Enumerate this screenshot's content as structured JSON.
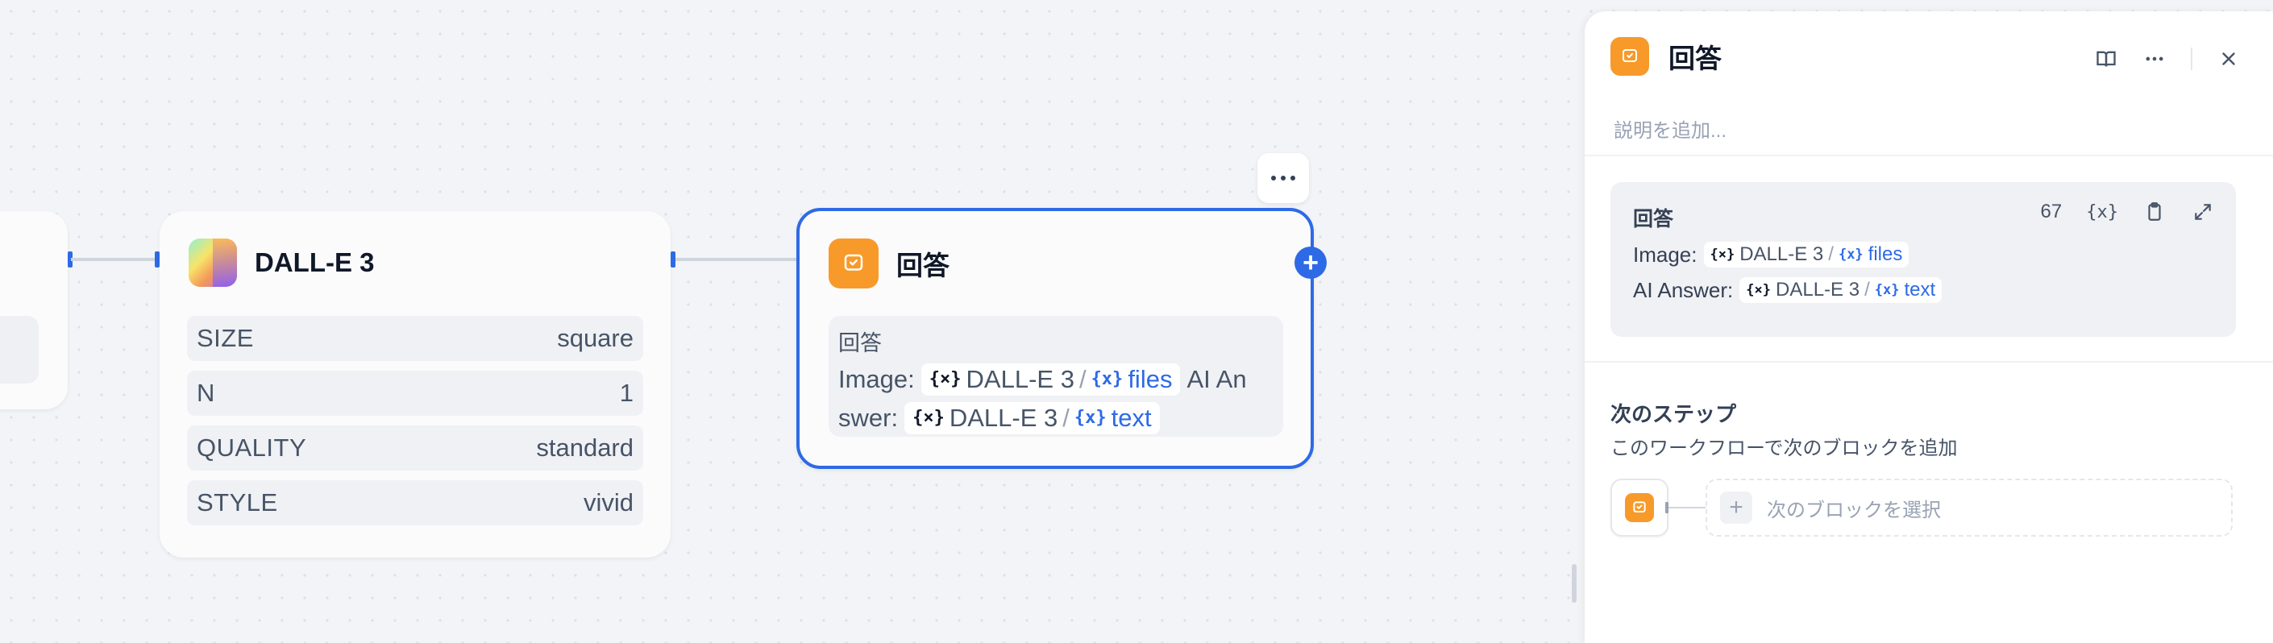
{
  "colors": {
    "accent": "#2e6ae6",
    "answer_icon_bg": "#f79a2a",
    "canvas_bg": "#f2f4f7"
  },
  "canvas": {
    "dalle_node": {
      "title": "DALL-E 3",
      "icon": "dalle-logo-icon",
      "params": [
        {
          "key": "SIZE",
          "value": "square"
        },
        {
          "key": "N",
          "value": "1"
        },
        {
          "key": "QUALITY",
          "value": "standard"
        },
        {
          "key": "STYLE",
          "value": "vivid"
        }
      ]
    },
    "answer_node": {
      "title": "回答",
      "icon": "answer-icon",
      "body_label": "回答",
      "line1_prefix": "Image:",
      "line1_chip": {
        "source": "DALL-E 3",
        "separator": "/",
        "variable": "files"
      },
      "line1_suffix": "AI An",
      "line2_prefix": "swer:",
      "line2_chip": {
        "source": "DALL-E 3",
        "separator": "/",
        "variable": "text"
      },
      "var_icon": "{×}",
      "var_icon_blue": "{x}"
    },
    "add_button": "+"
  },
  "panel": {
    "title": "回答",
    "description_placeholder": "説明を追加...",
    "card": {
      "title": "回答",
      "count": "67",
      "var_button": "{x}",
      "line1_label": "Image:",
      "line1_chip": {
        "source": "DALL-E 3",
        "separator": "/",
        "variable": "files"
      },
      "line2_label": "AI Answer:",
      "line2_chip": {
        "source": "DALL-E 3",
        "separator": "/",
        "variable": "text"
      }
    },
    "next_step": {
      "title": "次のステップ",
      "subtitle": "このワークフローで次のブロックを追加",
      "select_label": "次のブロックを選択",
      "plus": "+"
    }
  }
}
